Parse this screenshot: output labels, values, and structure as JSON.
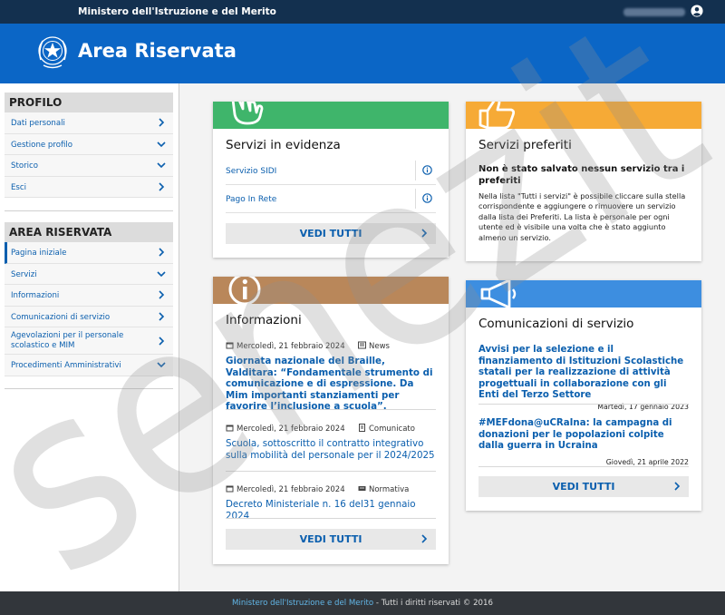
{
  "topbar": {
    "ministry": "Ministero dell'Istruzione e del Merito",
    "user_icon": "user-circle-icon"
  },
  "header": {
    "title": "Area Riservata",
    "emblem": "republic-emblem-icon"
  },
  "sidebar": {
    "profilo": {
      "heading": "PROFILO",
      "items": [
        {
          "label": "Dati personali",
          "icon": "chevron-right-icon"
        },
        {
          "label": "Gestione profilo",
          "icon": "chevron-down-icon"
        },
        {
          "label": "Storico",
          "icon": "chevron-down-icon"
        },
        {
          "label": "Esci",
          "icon": "chevron-right-icon"
        }
      ]
    },
    "area": {
      "heading": "AREA RISERVATA",
      "items": [
        {
          "label": "Pagina iniziale",
          "icon": "chevron-right-icon"
        },
        {
          "label": "Servizi",
          "icon": "chevron-down-icon"
        },
        {
          "label": "Informazioni",
          "icon": "chevron-right-icon"
        },
        {
          "label": "Comunicazioni di servizio",
          "icon": "chevron-right-icon"
        },
        {
          "label": "Agevolazioni per il personale scolastico e MIM",
          "icon": "chevron-right-icon"
        },
        {
          "label": "Procedimenti Amministrativi",
          "icon": "chevron-down-icon"
        }
      ]
    }
  },
  "evidenza": {
    "title": "Servizi in evidenza",
    "band_color": "#3fb56b",
    "services": [
      {
        "label": "Servizio SIDI"
      },
      {
        "label": "Pago In Rete"
      }
    ],
    "button": "VEDI TUTTI"
  },
  "preferiti": {
    "title": "Servizi preferiti",
    "band_color": "#f6aa36",
    "empty_title": "Non è stato salvato nessun servizio tra i preferiti",
    "body": "Nella lista \"Tutti i servizi\" è possibile cliccare sulla stella corrispondente e aggiungere o rimuovere un servizio dalla lista dei Preferiti. La lista è personale per ogni utente ed è visibile una volta che è stato aggiunto almeno un servizio."
  },
  "informazioni": {
    "title": "Informazioni",
    "band_color": "#b9875a",
    "items": [
      {
        "date": "Mercoledì, 21 febbraio 2024",
        "category": "News",
        "title": "Giornata nazionale del Braille, Valditara: “Fondamentale strumento di comunicazione e di espressione. Da Mim importanti stanziamenti per favorire l’inclusione a scuola”."
      },
      {
        "date": "Mercoledì, 21 febbraio 2024",
        "category": "Comunicato",
        "title": "Scuola, sottoscritto il contratto integrativo sulla mobilità del personale per il 2024/2025"
      },
      {
        "date": "Mercoledì, 21 febbraio 2024",
        "category": "Normativa",
        "title": "Decreto Ministeriale n. 16 del31 gennaio 2024"
      }
    ],
    "button": "VEDI TUTTI"
  },
  "comunicazioni": {
    "title": "Comunicazioni di servizio",
    "band_color": "#3d8ee0",
    "items": [
      {
        "title": "Avvisi per la selezione e il finanziamento di Istituzioni Scolastiche statali per la realizzazione di attività progettuali in collaborazione con gli Enti del Terzo Settore",
        "date": "Martedì, 17 gennaio 2023"
      },
      {
        "title": "#MEFdona@uCRaIna: la campagna di donazioni per le popolazioni colpite dalla guerra in Ucraina",
        "date": "Giovedì, 21 aprile 2022"
      }
    ],
    "button": "VEDI TUTTI"
  },
  "watermark": "senezit",
  "footer": {
    "link": "Ministero dell'Istruzione e del Merito",
    "rest": " - Tutti i diritti riservati © 2016"
  }
}
